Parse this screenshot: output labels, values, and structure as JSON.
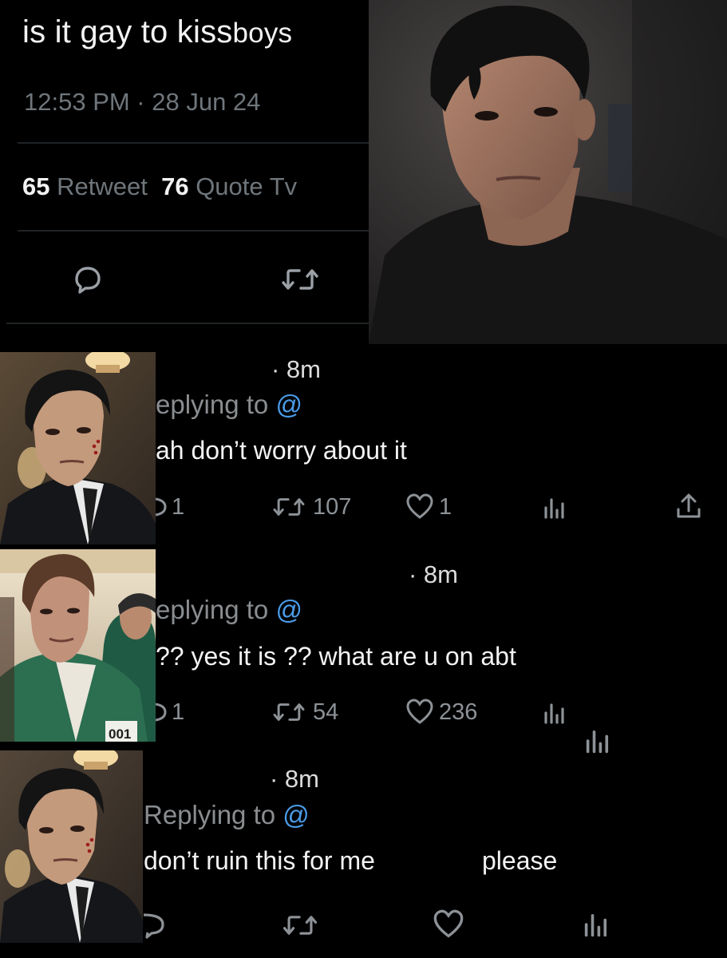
{
  "tweet": {
    "text_part1": "is it gay to kiss",
    "text_part2": "boys",
    "timestamp": "12:53 PM · 28 Jun 24",
    "retweet_count": "65",
    "retweet_label": "Retweet",
    "quote_count": "76",
    "quote_label": "Quote Tv"
  },
  "replies": [
    {
      "time": "· 8m",
      "replying_prefix": "eplying to",
      "handle": "@",
      "text": "ah don’t worry about it",
      "reply_count": "1",
      "retweet_count": "107",
      "like_count": "1"
    },
    {
      "time": "· 8m",
      "replying_prefix": "eplying to",
      "handle": "@",
      "text": "?? yes it is ?? what are u on abt",
      "reply_count": "1",
      "retweet_count": "54",
      "like_count": "236"
    },
    {
      "time": "· 8m",
      "replying_prefix": "Replying to",
      "handle": "@",
      "text": "don’t ruin this for me",
      "text_extra": "please"
    }
  ],
  "icons": {
    "reply": "speech-bubble-icon",
    "retweet": "retweet-icon",
    "like": "heart-icon",
    "views": "bar-chart-icon",
    "share": "share-icon"
  },
  "colors": {
    "background": "#000000",
    "text": "#f3f3f3",
    "muted": "#6f767b",
    "handle": "#4a9be8"
  },
  "photos": {
    "badge_number": "001"
  }
}
